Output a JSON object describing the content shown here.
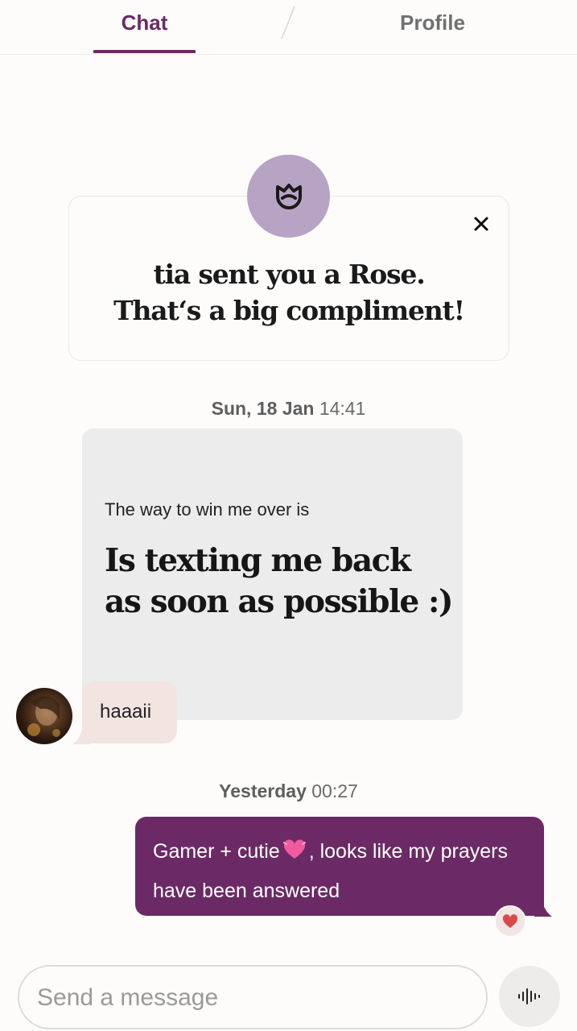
{
  "tabs": {
    "chat": "Chat",
    "profile": "Profile"
  },
  "rose": {
    "icon": "rose-icon",
    "line1": "tia sent you a Rose.",
    "line2": "That‘s a big compliment!",
    "close_icon": "close-icon"
  },
  "timestamps": [
    {
      "day": "Sun, 18 Jan",
      "time": "14:41"
    },
    {
      "day": "Yesterday",
      "time": "00:27"
    }
  ],
  "prompt": {
    "question": "The way to win me over is",
    "answer_line1": "Is texting me back",
    "answer_line2": "as soon as possible :)"
  },
  "incoming": {
    "avatar": "profile-photo",
    "text": "haaaii"
  },
  "outgoing": {
    "text_before_emoji": "Gamer + cutie",
    "emoji": "💓",
    "text_after_emoji": ", looks like my prayers have been answered",
    "reaction_icon": "heart-icon"
  },
  "composer": {
    "placeholder": "Send a message",
    "value": "",
    "voice_icon": "voice-wave-icon"
  },
  "colors": {
    "accent": "#6b2a65",
    "rose_badge": "#b7a3c3",
    "incoming_bubble": "#f1e4e1",
    "prompt_card": "#ececec",
    "heart": "#d94a4a"
  }
}
